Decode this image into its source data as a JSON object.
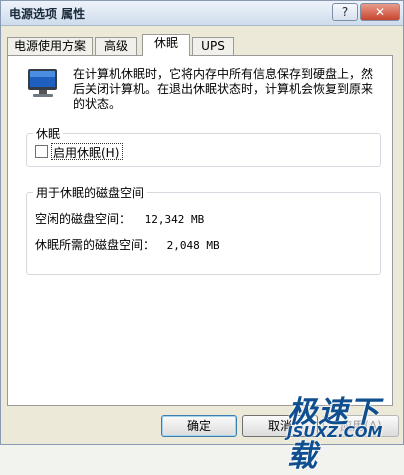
{
  "window": {
    "title": "电源选项 属性",
    "help_glyph": "?",
    "close_glyph": "✕"
  },
  "tabs": [
    {
      "label": "电源使用方案"
    },
    {
      "label": "高级"
    },
    {
      "label": "休眠"
    },
    {
      "label": "UPS"
    }
  ],
  "active_tab_index": 2,
  "description": "在计算机休眠时，它将内存中所有信息保存到硬盘上，然后关闭计算机。在退出休眠状态时，计算机会恢复到原来的状态。",
  "hibernate_group": {
    "title": "休眠",
    "checkbox_label": "启用休眠(H)",
    "checked": false
  },
  "disk_group": {
    "title": "用于休眠的磁盘空间",
    "free_label": "空闲的磁盘空间：",
    "free_value": "12,342 MB",
    "needed_label": "休眠所需的磁盘空间：",
    "needed_value": "2,048 MB"
  },
  "buttons": {
    "ok": "确定",
    "cancel": "取消",
    "apply": "应用(A)"
  },
  "watermark": {
    "main": "极速下载",
    "sub": "JSUXZ.COM"
  },
  "colors": {
    "monitor_screen": "#1f5fbf",
    "watermark": "#0f4f8f"
  }
}
